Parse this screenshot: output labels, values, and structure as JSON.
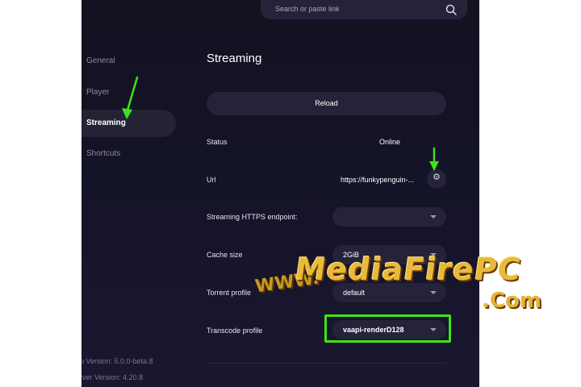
{
  "search": {
    "placeholder": "Search or paste link",
    "icon": "search-icon"
  },
  "sidebar": {
    "items": [
      {
        "label": "General",
        "active": false
      },
      {
        "label": "Player",
        "active": false
      },
      {
        "label": "Streaming",
        "active": true
      },
      {
        "label": "Shortcuts",
        "active": false
      }
    ],
    "app_version": "p Version: 5.0.0-beta.8",
    "server_version": "rver Version: 4.20.8"
  },
  "main": {
    "title": "Streaming",
    "reload_label": "Reload",
    "rows": {
      "status": {
        "label": "Status",
        "value": "Online"
      },
      "url": {
        "label": "Url",
        "value": "https://funkypenguin-...",
        "icon": "gear-icon"
      },
      "https_endpoint": {
        "label": "Streaming HTTPS endpoint:",
        "value": ""
      },
      "cache_size": {
        "label": "Cache size",
        "value": "2GiB"
      },
      "torrent_profile": {
        "label": "Torrent profile",
        "value": "default"
      },
      "transcode_profile": {
        "label": "Transcode profile",
        "value": "vaapi-renderD128"
      }
    }
  },
  "watermark": {
    "main": "MediaFirePC",
    "www": "WWW.",
    "com": ".Com"
  },
  "colors": {
    "accent_highlight": "#3fe21a",
    "background": "#131220",
    "watermark": "#e9b93a"
  }
}
